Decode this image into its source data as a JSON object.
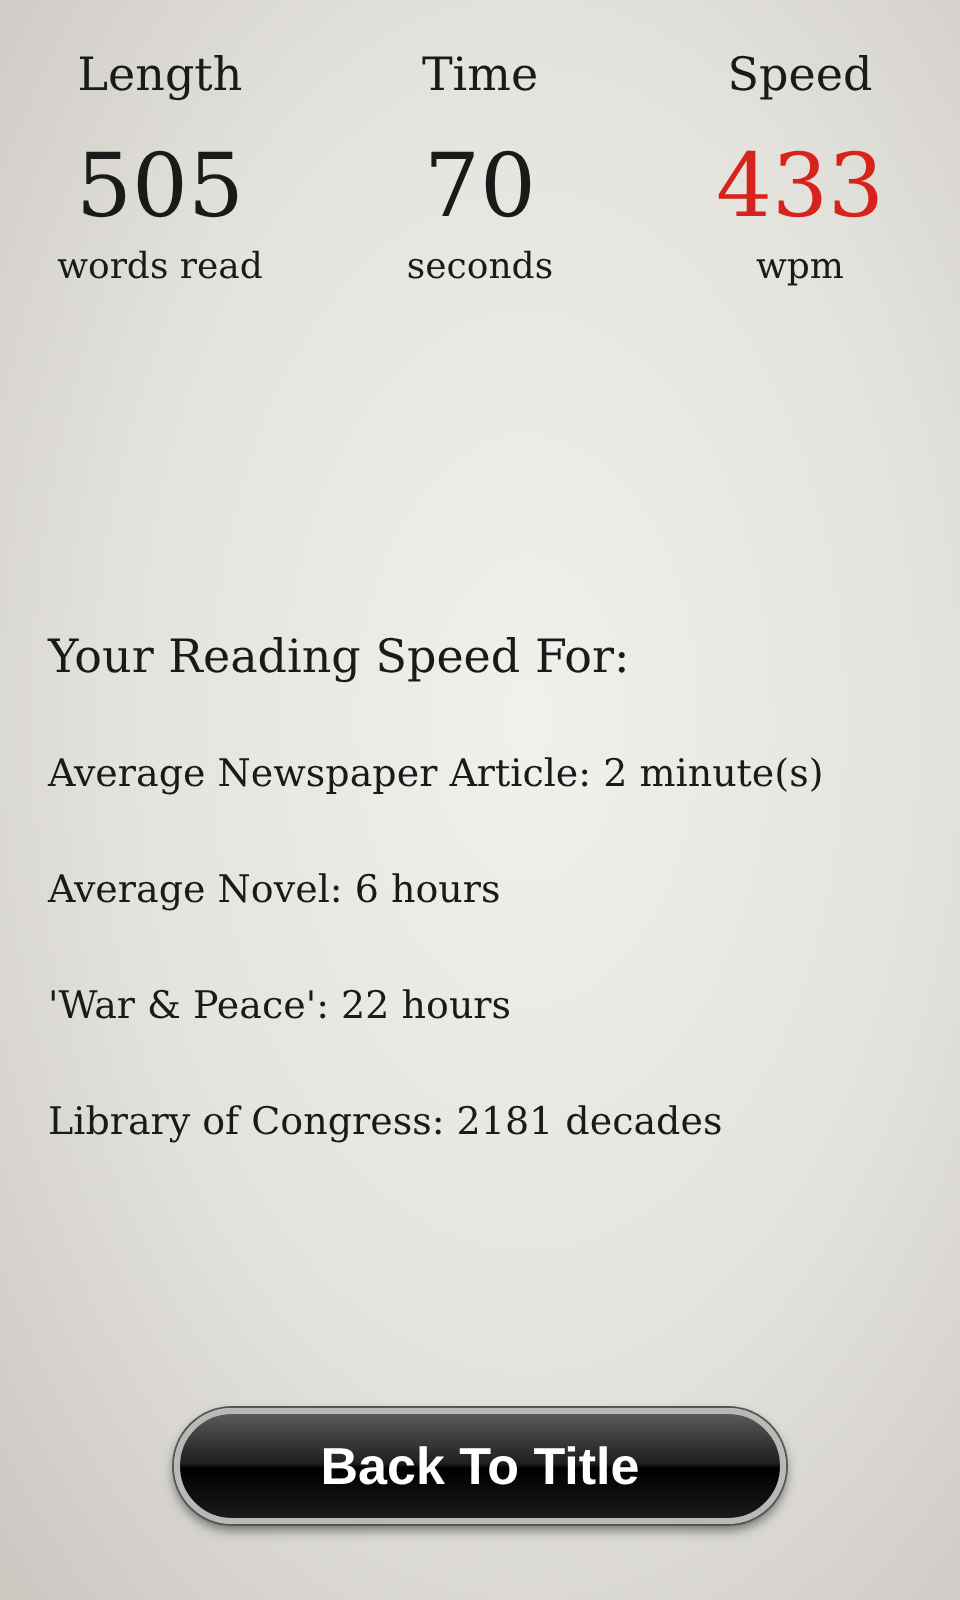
{
  "stats": [
    {
      "label": "Length",
      "value": "505",
      "unit": "words read",
      "highlighted": false
    },
    {
      "label": "Time",
      "value": "70",
      "unit": "seconds",
      "highlighted": false
    },
    {
      "label": "Speed",
      "value": "433",
      "unit": "wpm",
      "highlighted": true
    }
  ],
  "estimates": {
    "heading": "Your Reading Speed For:",
    "lines": [
      "Average Newspaper Article: 2 minute(s)",
      "Average Novel: 6 hours",
      "'War & Peace': 22 hours",
      "Library of Congress: 2181 decades"
    ]
  },
  "button": {
    "label": "Back To Title"
  }
}
